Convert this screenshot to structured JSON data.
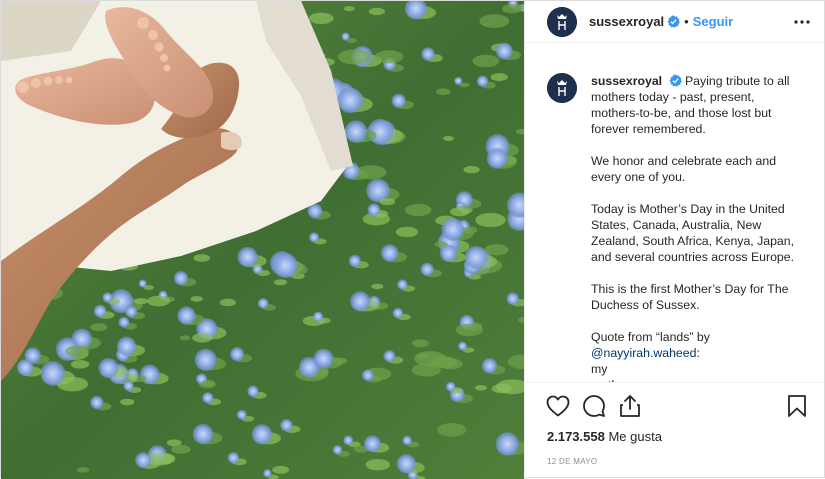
{
  "header": {
    "username": "sussexroyal",
    "separator": "•",
    "follow_label": "Seguir",
    "verified_icon": "verified-badge-icon",
    "more_icon": "more-options-icon"
  },
  "caption": {
    "username": "sussexroyal",
    "paragraphs": [
      "Paying tribute to all mothers today - past, present, mothers-to-be, and those lost but forever remembered.",
      "We honor and celebrate each and every one of you.",
      "Today is Mother’s Day in the United States, Canada, Australia, New Zealand, South Africa, Kenya, Japan, and several countries across Europe.",
      "This is the first Mother’s Day for The Duchess of Sussex.",
      "Quote from “lands” by"
    ],
    "mention": "@nayyirah.waheed",
    "mention_suffix": ":",
    "tail_lines": [
      "my",
      "mother"
    ]
  },
  "actions": {
    "like_icon": "heart-icon",
    "comment_icon": "comment-icon",
    "share_icon": "share-icon",
    "save_icon": "bookmark-icon"
  },
  "likes": {
    "count": "2.173.558",
    "label": "Me gusta"
  },
  "date": "12 DE MAYO",
  "colors": {
    "accent": "#3897f0",
    "avatar_bg": "#1f2f4e",
    "mention": "#003569",
    "muted": "#8e8e8e"
  }
}
